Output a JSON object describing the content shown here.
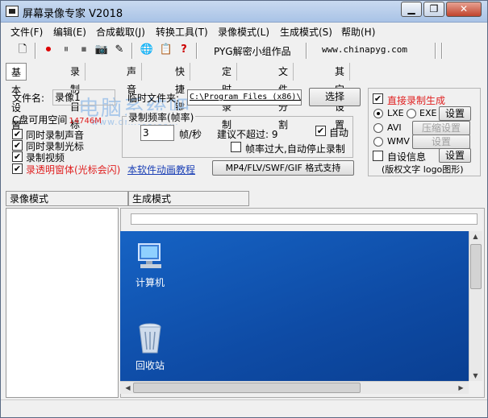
{
  "window": {
    "title": "屏幕录像专家 V2018",
    "minimize_label": "▁",
    "restore_label": "❐",
    "close_label": "✕"
  },
  "menu": [
    "文件(F)",
    "编辑(E)",
    "合成截取(J)",
    "转换工具(T)",
    "录像模式(L)",
    "生成模式(S)",
    "帮助(H)"
  ],
  "toolbar": {
    "credit": "PYG解密小组作品",
    "url": "www.chinapyg.com"
  },
  "tabs": [
    "基本设置",
    "录制目标",
    "声音",
    "快捷键",
    "定时录制",
    "文件分割",
    "其它设置"
  ],
  "basic": {
    "filename_label": "文件名:",
    "filename_value": "录像1",
    "temp_label": "临时文件夹:",
    "temp_value": "C:\\Program Files (x86)\\",
    "browse_button": "选择",
    "disk_prefix": "C盘可用空间",
    "disk_value": "14746M",
    "cb_audio": "同时录制声音",
    "cb_cursor": "同时录制光标",
    "cb_video": "录制视频",
    "cb_transparent": "录透明窗体(光标会闪)",
    "framerate_group": "录制频率(帧率)",
    "framerate_value": "3",
    "framerate_unit": "帧/秒",
    "suggest_label": "建议不超过:",
    "suggest_value": "9",
    "auto_label": "自动",
    "auto_stop_label": "帧率过大,自动停止录制",
    "tutorial_link": "本软件动画教程",
    "format_button": "MP4/FLV/SWF/GIF 格式支持"
  },
  "output": {
    "direct_label": "直接录制生成",
    "lxe": "LXE",
    "exe": "EXE",
    "avi": "AVI",
    "wmv": "WMV",
    "settings_button": "设置",
    "compress_button": "压缩设置",
    "settings2_button": "设置",
    "custom_info_label": "自设信息",
    "settings3_button": "设置",
    "logo_note": "(版权文字 logo图形)"
  },
  "watermark": {
    "text": "电脑系统吧",
    "domain": "www.dnxtc8.com"
  },
  "lower_tabs": [
    "录像模式",
    "生成模式"
  ],
  "desktop_icons": [
    {
      "name": "计算机",
      "icon": "computer-icon"
    },
    {
      "name": "回收站",
      "icon": "recycle-bin-icon"
    }
  ],
  "colors": {
    "desktop": "#1257b8",
    "accent": "#e02020",
    "link": "#1a3fb5"
  }
}
